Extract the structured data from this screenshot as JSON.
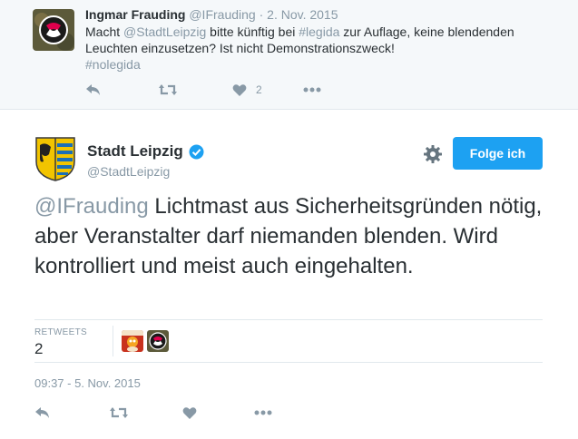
{
  "parent_tweet": {
    "name": "Ingmar Frauding",
    "handle": "@IFrauding",
    "dot": "·",
    "date": "2. Nov. 2015",
    "text_1": "Macht ",
    "mention": "@StadtLeipzig",
    "text_2": " bitte künftig bei ",
    "hashtag1": "#legida",
    "text_3": " zur Auflage, keine blendenden Leuchten einzusetzen? Ist nicht Demonstrationszweck!",
    "hashtag2": "#nolegida",
    "like_count": "2"
  },
  "main_tweet": {
    "name": "Stadt Leipzig",
    "handle": "@StadtLeipzig",
    "follow_label": "Folge ich",
    "mention": "@IFrauding",
    "text": " Lichtmast aus Sicherheitsgründen nötig, aber Veranstalter darf niemanden blenden. Wird  kontrolliert und meist auch eingehalten.",
    "retweets_label": "RETWEETS",
    "retweets_count": "2",
    "timestamp": "09:37 - 5. Nov. 2015"
  },
  "colors": {
    "accent": "#1da1f2",
    "muted": "#8899a6",
    "text": "#292f33",
    "antifa_red": "#e0004d"
  },
  "icons": [
    "reply-icon",
    "retweet-icon",
    "heart-icon",
    "more-icon",
    "gear-icon",
    "verified-icon"
  ]
}
